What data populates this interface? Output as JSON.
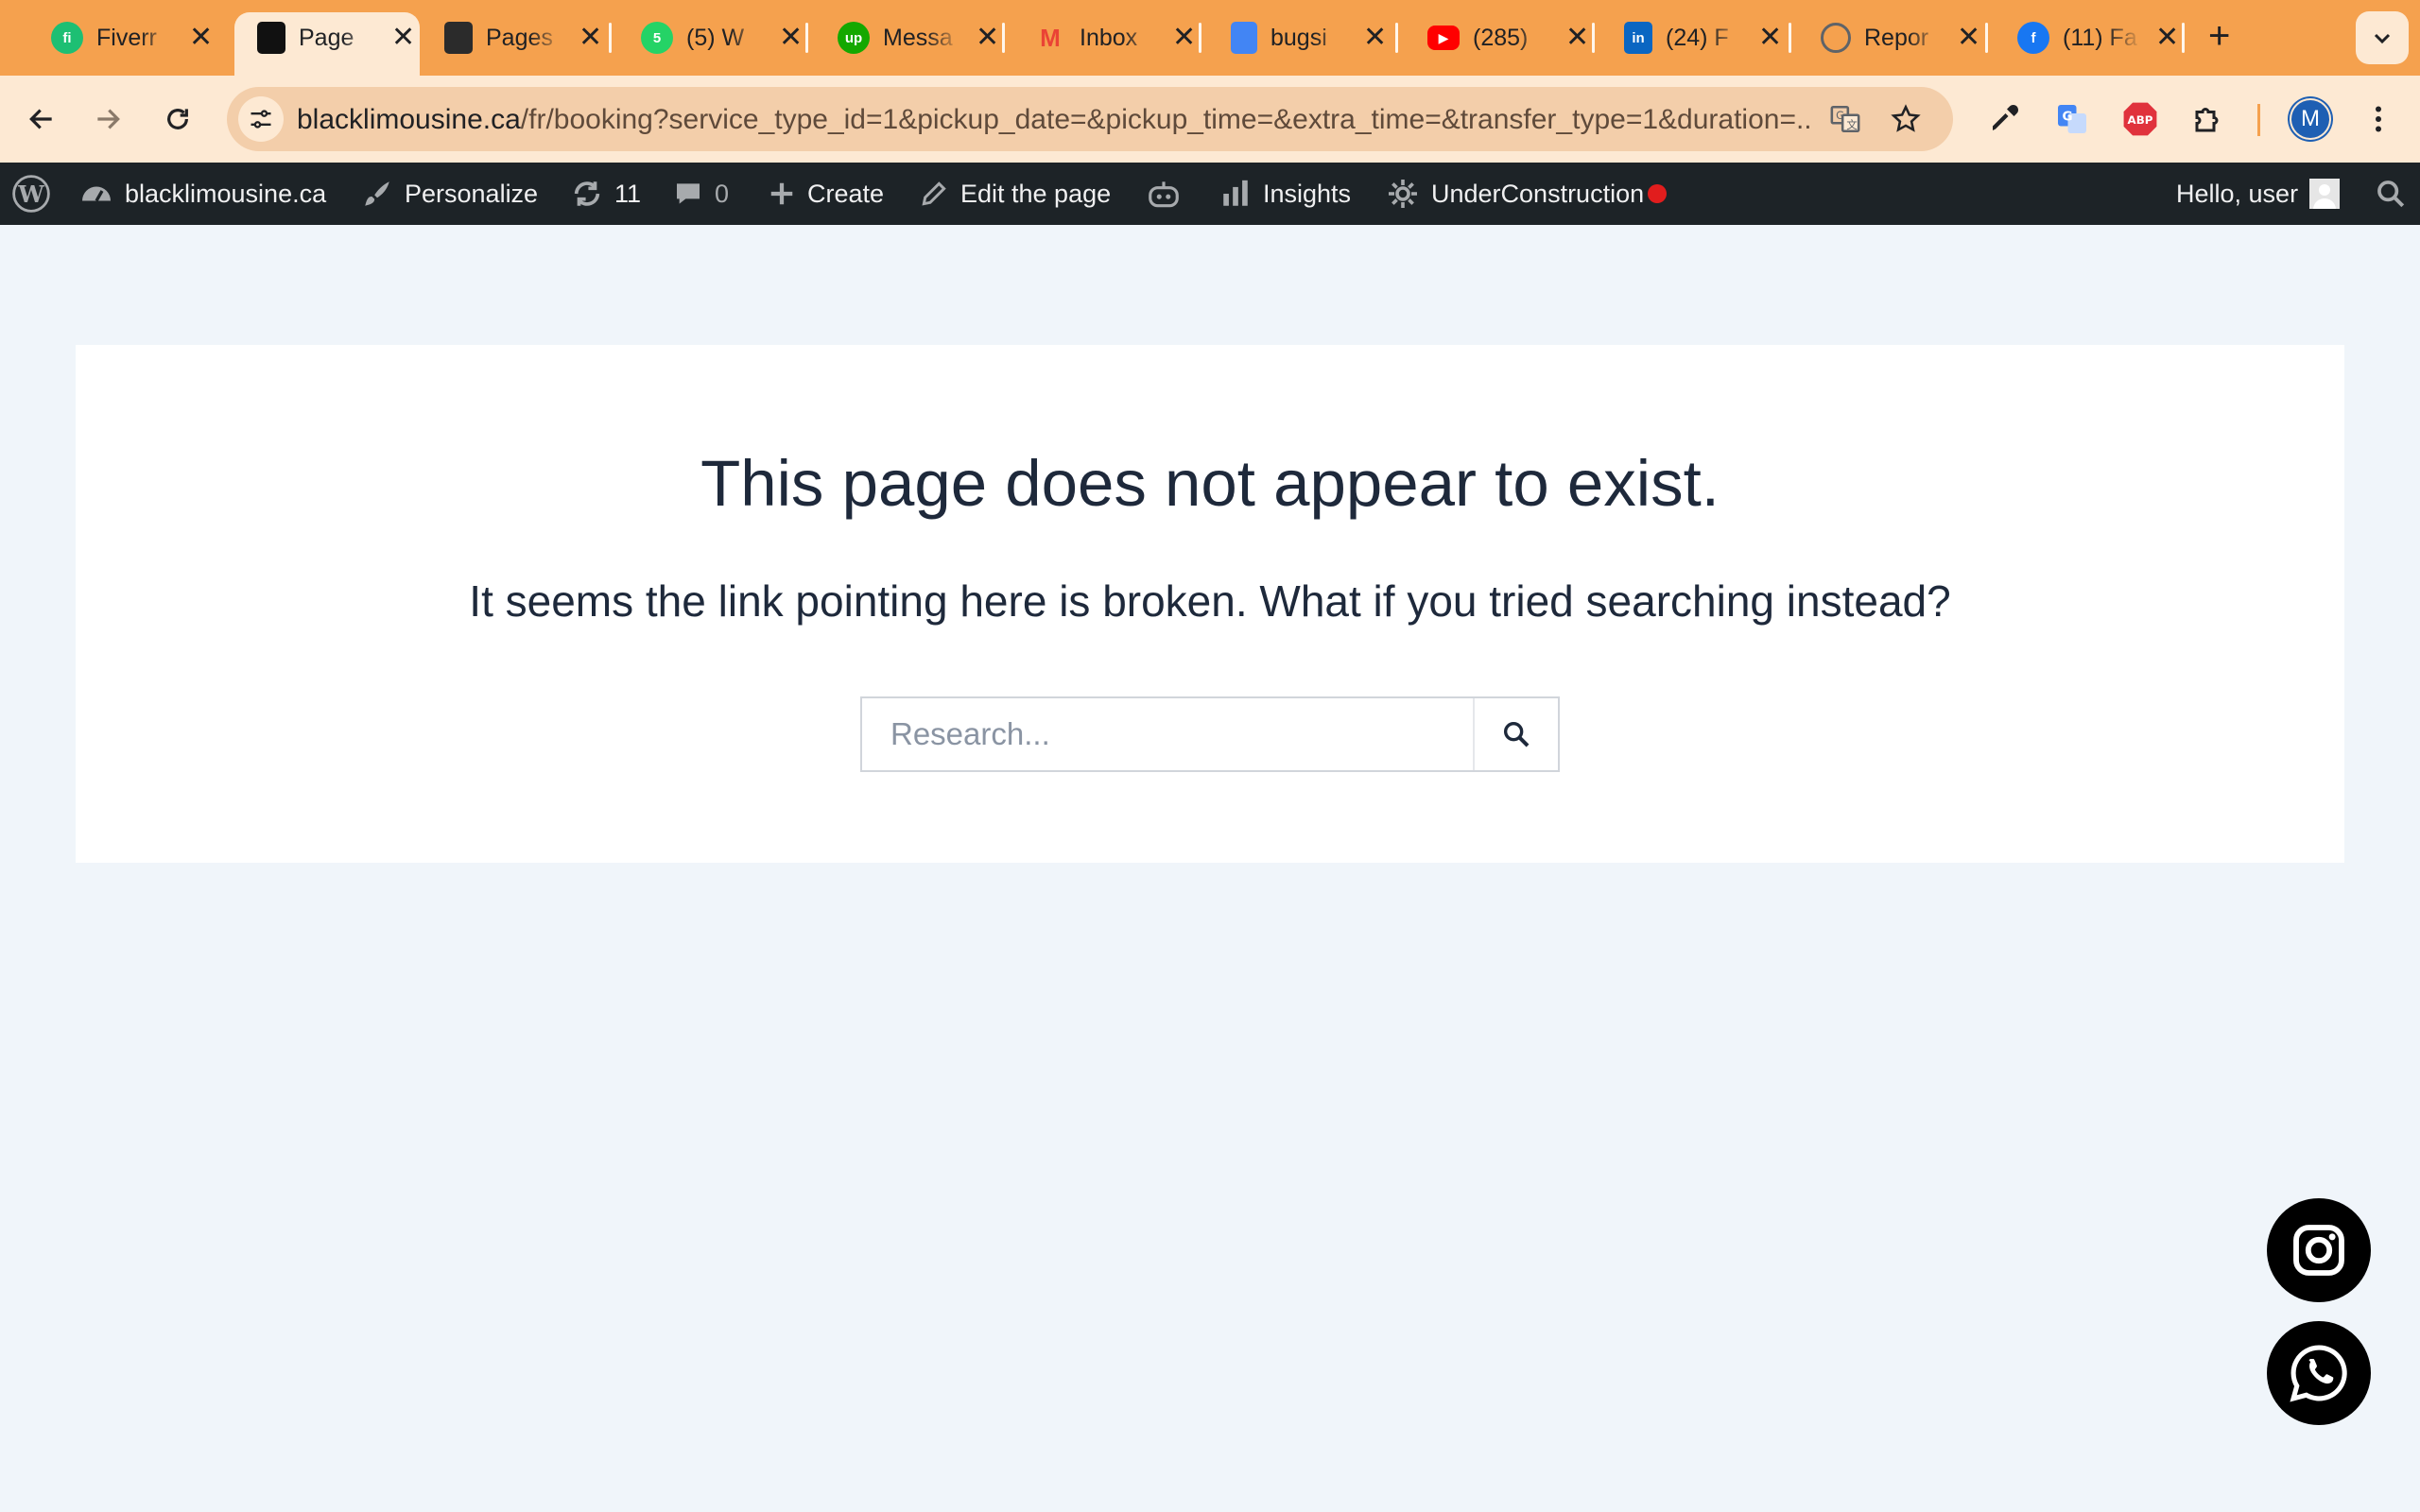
{
  "browser": {
    "tabs": [
      {
        "title": "Fiverr",
        "icon": "fiverr-icon",
        "color": "#1dbf73",
        "glyph": "fi"
      },
      {
        "title": "Page",
        "icon": "blacklimousine-icon",
        "color": "#111111",
        "glyph": "",
        "active": true
      },
      {
        "title": "Pages",
        "icon": "bug-icon",
        "color": "#2b2b2b",
        "glyph": ""
      },
      {
        "title": "(5) W",
        "icon": "whatsapp-icon",
        "color": "#25d366",
        "glyph": "5"
      },
      {
        "title": "Messa",
        "icon": "upwork-icon",
        "color": "#14a800",
        "glyph": "up"
      },
      {
        "title": "Inbox",
        "icon": "gmail-icon",
        "color": "#ffffff",
        "glyph": "M"
      },
      {
        "title": "bugsi",
        "icon": "google-docs-icon",
        "color": "#4285f4",
        "glyph": ""
      },
      {
        "title": "(285)",
        "icon": "youtube-icon",
        "color": "#ff0000",
        "glyph": "▶"
      },
      {
        "title": "(24) F",
        "icon": "linkedin-icon",
        "color": "#0a66c2",
        "glyph": "in"
      },
      {
        "title": "Repor",
        "icon": "report-icon",
        "color": "#5f6368",
        "glyph": ""
      },
      {
        "title": "(11) Fa",
        "icon": "facebook-icon",
        "color": "#1877f2",
        "glyph": "f"
      }
    ],
    "close_glyph": "✕",
    "new_tab_glyph": "+",
    "url_host": "blacklimousine.ca",
    "url_path": "/fr/booking?service_type_id=1&pickup_date=&pickup_time=&extra_time=&transfer_type=1&duration=...",
    "profile_initial": "M",
    "abp_label": "ABP"
  },
  "adminbar": {
    "site_name": "blacklimousine.ca",
    "personalize": "Personalize",
    "updates_count": "11",
    "comments_count": "0",
    "create": "Create",
    "edit_page": "Edit the page",
    "insights": "Insights",
    "under_construction": "UnderConstruction",
    "greeting": "Hello, user"
  },
  "content": {
    "headline": "This page does not appear to exist.",
    "subline": "It seems the link pointing here is broken. What if you tried searching instead?",
    "search_placeholder": "Research..."
  },
  "colors": {
    "tab_strip": "#f5a14e",
    "toolbar": "#fde9d3",
    "admin_bar": "#1d2327",
    "page_bg": "#f0f5fa"
  }
}
